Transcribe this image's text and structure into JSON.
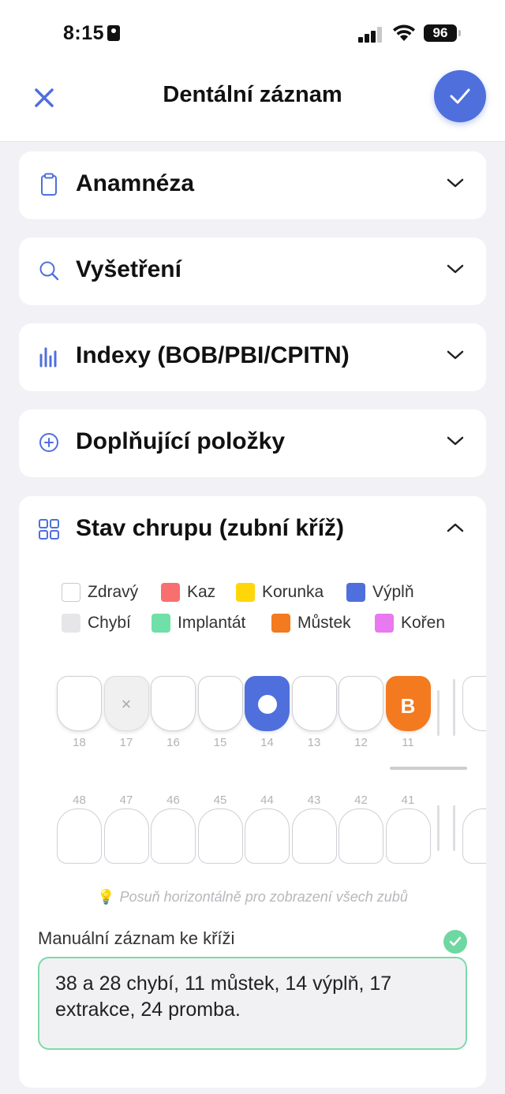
{
  "status": {
    "time": "8:15",
    "battery": "96"
  },
  "nav": {
    "title": "Dentální záznam"
  },
  "sections": [
    {
      "label": "Anamnéza",
      "icon": "clipboard-icon"
    },
    {
      "label": "Vyšetření",
      "icon": "search-icon"
    },
    {
      "label": "Indexy (BOB/PBI/CPITN)",
      "icon": "bar-chart-icon"
    },
    {
      "label": "Doplňující položky",
      "icon": "plus-circle-icon"
    }
  ],
  "chart_panel": {
    "title": "Stav chrupu (zubní kříž)",
    "icon": "grid-icon",
    "expanded": true,
    "legend": [
      {
        "label": "Zdravý",
        "color": "#ffffff"
      },
      {
        "label": "Kaz",
        "color": "#f76f6f"
      },
      {
        "label": "Korunka",
        "color": "#ffd60a"
      },
      {
        "label": "Výplň",
        "color": "#4f6fdc"
      },
      {
        "label": "Chybí",
        "color": "#e6e6e8"
      },
      {
        "label": "Implantát",
        "color": "#6fe0a8"
      },
      {
        "label": "Můstek",
        "color": "#f47a1f"
      },
      {
        "label": "Kořen",
        "color": "#e879f0"
      }
    ],
    "upper_teeth": [
      {
        "number": "18",
        "state": "healthy",
        "mark": ""
      },
      {
        "number": "17",
        "state": "missing",
        "mark": "×"
      },
      {
        "number": "16",
        "state": "healthy",
        "mark": ""
      },
      {
        "number": "15",
        "state": "healthy",
        "mark": ""
      },
      {
        "number": "14",
        "state": "filling",
        "mark": ""
      },
      {
        "number": "13",
        "state": "healthy",
        "mark": ""
      },
      {
        "number": "12",
        "state": "healthy",
        "mark": ""
      },
      {
        "number": "11",
        "state": "bridge",
        "mark": "B"
      }
    ],
    "lower_teeth": [
      {
        "number": "48",
        "state": "healthy"
      },
      {
        "number": "47",
        "state": "healthy"
      },
      {
        "number": "46",
        "state": "healthy"
      },
      {
        "number": "45",
        "state": "healthy"
      },
      {
        "number": "44",
        "state": "healthy"
      },
      {
        "number": "43",
        "state": "healthy"
      },
      {
        "number": "42",
        "state": "healthy"
      },
      {
        "number": "41",
        "state": "healthy"
      }
    ],
    "hint": "Posuň horizontálně pro zobrazení všech zubů",
    "manual_label": "Manuální záznam ke kříži",
    "manual_value": "38 a 28 chybí, 11 můstek, 14 výplň, 17 extrakce, 24 promba."
  }
}
